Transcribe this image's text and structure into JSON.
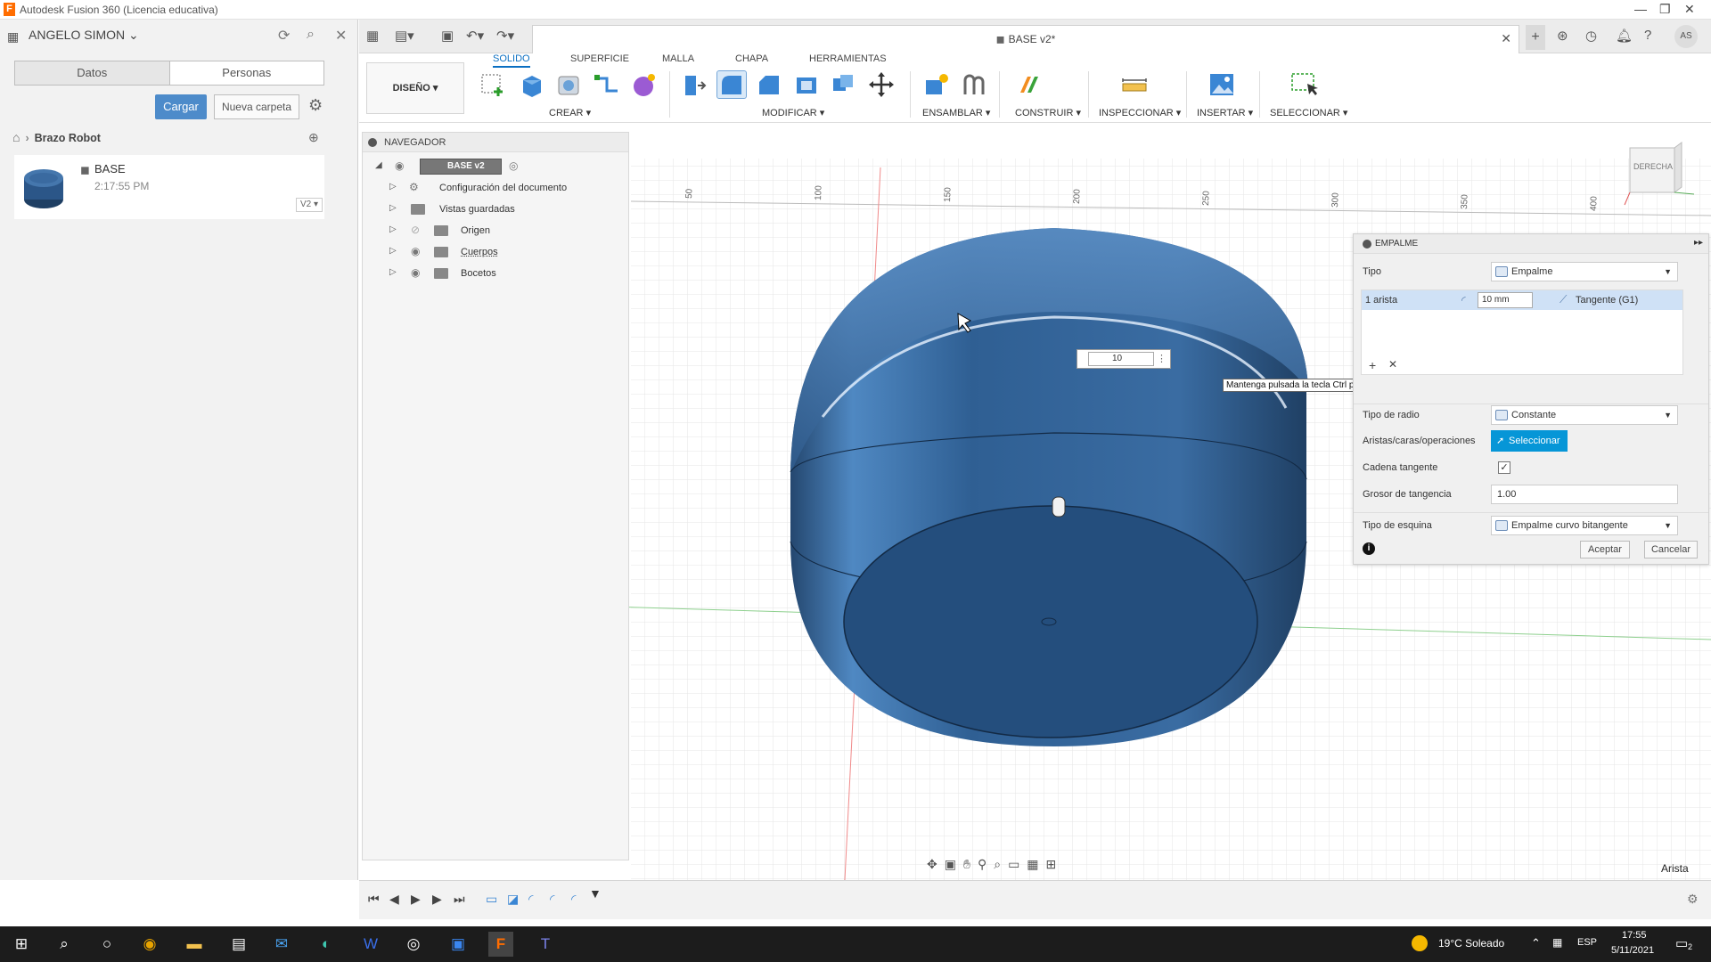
{
  "window": {
    "title": "Autodesk Fusion 360 (Licencia educativa)",
    "logo_letter": "F"
  },
  "data_panel": {
    "user": "ANGELO SIMON",
    "tabs": [
      "Datos",
      "Personas"
    ],
    "upload_label": "Cargar",
    "new_folder_label": "Nueva carpeta",
    "breadcrumb": "Brazo Robot",
    "file": {
      "name": "BASE",
      "time": "2:17:55 PM",
      "version": "V2"
    }
  },
  "document": {
    "tab_title": "BASE v2*",
    "avatar": "AS"
  },
  "toolbar": {
    "tabs": [
      "SOLIDO",
      "SUPERFICIE",
      "MALLA",
      "CHAPA",
      "HERRAMIENTAS"
    ],
    "active_tab": "SOLIDO",
    "workspace": "DISEÑO",
    "groups": [
      "CREAR",
      "MODIFICAR",
      "ENSAMBLAR",
      "CONSTRUIR",
      "INSPECCIONAR",
      "INSERTAR",
      "SELECCIONAR"
    ]
  },
  "navigator": {
    "title": "NAVEGADOR",
    "root": "BASE v2",
    "items": [
      "Configuración del documento",
      "Vistas guardadas",
      "Origen",
      "Cuerpos",
      "Bocetos"
    ]
  },
  "viewcube": {
    "face": "DERECHA"
  },
  "ruler_ticks": [
    "50",
    "100",
    "150",
    "200",
    "250",
    "300",
    "350",
    "400"
  ],
  "fillet_panel": {
    "title": "EMPALME",
    "type_label": "Tipo",
    "type_value": "Empalme",
    "edge_row": {
      "label": "1 arista",
      "radius": "10 mm",
      "continuity": "Tangente (G1)"
    },
    "radius_type_label": "Tipo de radio",
    "radius_type_value": "Constante",
    "select_label": "Aristas/caras/operaciones",
    "select_button": "Seleccionar",
    "tangent_chain_label": "Cadena tangente",
    "tangent_chain_checked": true,
    "tangent_weight_label": "Grosor de tangencia",
    "tangent_weight_value": "1.00",
    "corner_type_label": "Tipo de esquina",
    "corner_type_value": "Empalme curvo bitangente",
    "accept": "Aceptar",
    "cancel": "Cancelar"
  },
  "canvas_dimension_input": "10",
  "tooltip": "Mantenga pulsada la tecla Ctrl para modificar la selección",
  "status": {
    "selection": "Arista"
  },
  "taskbar": {
    "weather": "19°C  Soleado",
    "lang": "ESP",
    "time": "17:55",
    "date": "5/11/2021",
    "notif_count": "2"
  },
  "colors": {
    "accent": "#0696d7",
    "body_blue": "#2d5d8f",
    "active_tab": "#0a6fc2"
  }
}
